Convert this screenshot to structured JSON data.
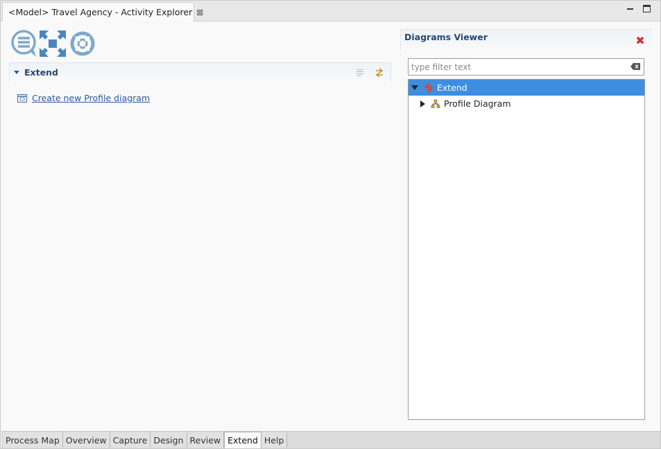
{
  "window": {
    "tab_title": "<Model> Travel Agency - Activity Explorer",
    "tab_close": "⊠"
  },
  "section": {
    "title": "Extend",
    "link_label": "Create new Profile diagram"
  },
  "viewer": {
    "title": "Diagrams Viewer",
    "close_glyph": "✖",
    "filter_placeholder": "type filter text",
    "tree": [
      {
        "label": "Extend",
        "expanded": true,
        "selected": true
      },
      {
        "label": "Profile Diagram",
        "expanded": false,
        "selected": false
      }
    ]
  },
  "bottom_tabs": [
    {
      "label": "Process Map",
      "active": false
    },
    {
      "label": "Overview",
      "active": false
    },
    {
      "label": "Capture",
      "active": false
    },
    {
      "label": "Design",
      "active": false
    },
    {
      "label": "Review",
      "active": false
    },
    {
      "label": "Extend",
      "active": true
    },
    {
      "label": "Help",
      "active": false
    }
  ],
  "colors": {
    "accent": "#3d8ee0",
    "section_title": "#26486e",
    "link": "#2a5b9c",
    "close": "#d0312d",
    "logo": "#7ea8c9"
  }
}
